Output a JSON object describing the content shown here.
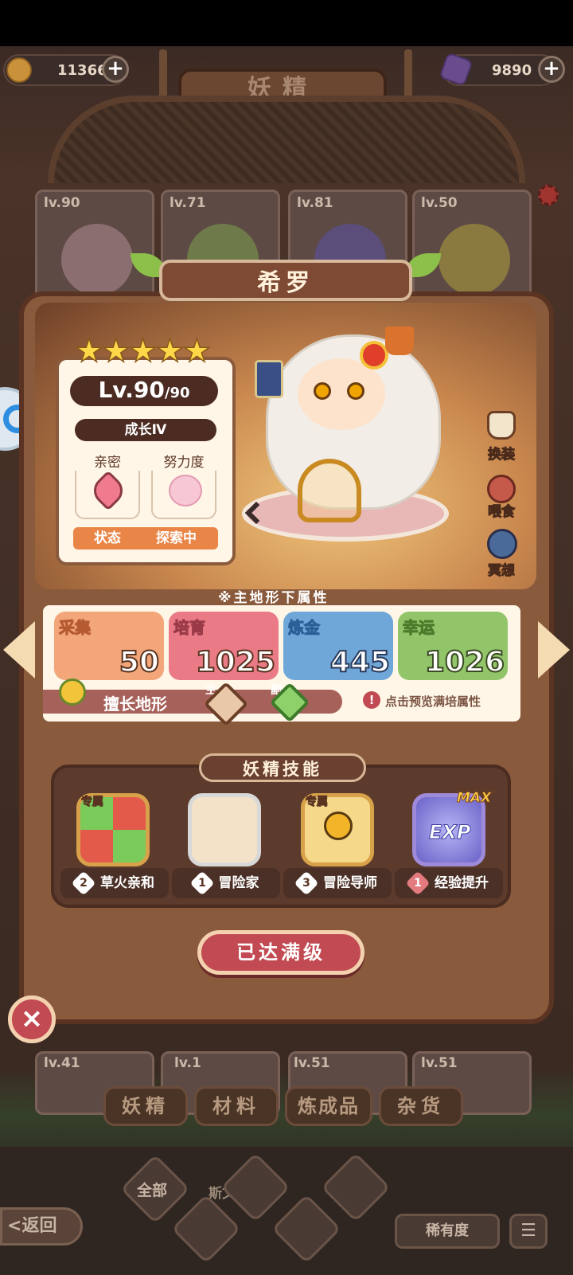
{
  "top_bar": {
    "coins": "11366",
    "gems": "9890",
    "title": "妖精"
  },
  "fairy_cards_top": [
    {
      "level": "lv.90"
    },
    {
      "level": "lv.71"
    },
    {
      "level": "lv.81"
    },
    {
      "level": "lv.50"
    }
  ],
  "fairy_cards_bottom": [
    {
      "level": "lv.41"
    },
    {
      "level": "lv.1"
    },
    {
      "level": "lv.51"
    },
    {
      "level": "lv.51"
    }
  ],
  "detail": {
    "name": "希罗",
    "stars": "★★★★★",
    "level": "Lv.90",
    "level_max": "/90",
    "growth": "成长Ⅳ",
    "intimacy_label": "亲密",
    "effort_label": "努力度",
    "status_label": "状态",
    "status_value": "探索中",
    "side_actions": [
      "换装",
      "喂食",
      "冥想"
    ],
    "attr_header": "※主地形下属性",
    "stats": [
      {
        "label": "采集",
        "value": "50",
        "color": "#f2a679"
      },
      {
        "label": "培育",
        "value": "1025",
        "color": "#e97a86"
      },
      {
        "label": "炼金",
        "value": "445",
        "color": "#6fa7d8"
      },
      {
        "label": "幸运",
        "value": "1026",
        "color": "#92c56a"
      }
    ],
    "terrain_label": "擅长地形",
    "terrain_main": "主",
    "terrain_sub": "副",
    "preview_hint": "点击预览满培属性",
    "skills_header": "妖精技能",
    "skills": [
      {
        "tag": "专属",
        "rank": "2",
        "name": "草火亲和"
      },
      {
        "tag": "",
        "rank": "1",
        "name": "冒险家"
      },
      {
        "tag": "专属",
        "rank": "3",
        "name": "冒险导师"
      },
      {
        "tag": "MAX",
        "rank": "1",
        "name": "经验提升"
      }
    ],
    "exp_label": "EXP",
    "max_button": "已达满级"
  },
  "bottom_tabs": [
    "妖精",
    "材料",
    "炼成品",
    "杂货"
  ],
  "filter": {
    "all": "全部",
    "behind_name": "斯文",
    "back": "返回",
    "rarity": "稀有度"
  },
  "colors": {
    "panel_border": "#6a3f26",
    "button": "#c24a52",
    "accent_orange": "#e98546"
  }
}
